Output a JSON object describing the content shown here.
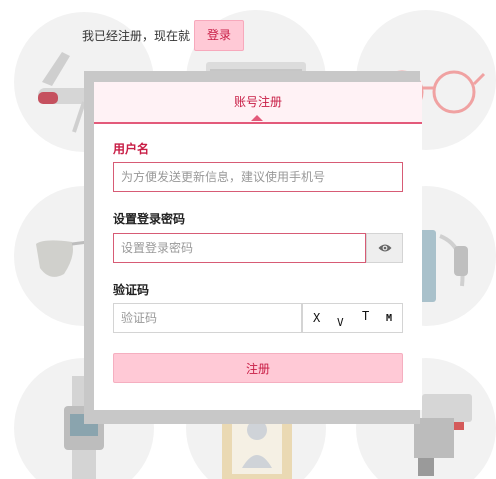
{
  "header": {
    "prompt_text": "我已经注册，现在就",
    "login_label": "登录"
  },
  "modal": {
    "tab_label": "账号注册",
    "username": {
      "label": "用户名",
      "placeholder": "为方便发送更新信息，建议使用手机号",
      "value": ""
    },
    "password": {
      "label": "设置登录密码",
      "placeholder": "设置登录密码",
      "value": "",
      "toggle_icon": "eye-icon"
    },
    "captcha": {
      "label": "验证码",
      "placeholder": "验证码",
      "value": "",
      "chars": [
        "X",
        "V",
        "T",
        "M"
      ]
    },
    "submit_label": "注册"
  },
  "colors": {
    "accent": "#c81d45",
    "button_bg": "#ffc9d6",
    "tab_bg": "#fff2f5",
    "error_border": "#d75b75",
    "overlay": "#c8c8c8"
  }
}
